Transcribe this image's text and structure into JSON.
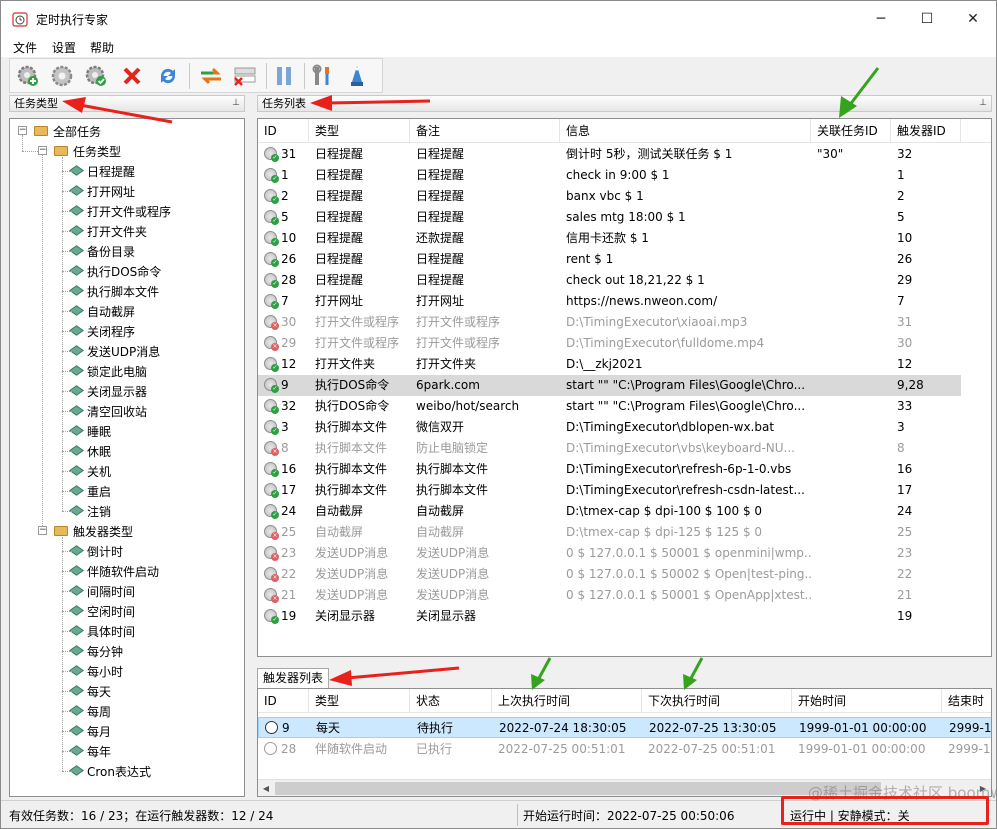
{
  "window": {
    "title": "定时执行专家",
    "minimize": "─",
    "maximize": "☐",
    "close": "✕"
  },
  "menu": [
    "文件",
    "设置",
    "帮助"
  ],
  "toolbar": {
    "buttons": [
      "add-task-icon",
      "gear-icon",
      "gear-check-icon",
      "delete-icon",
      "refresh-icon",
      "swap-icon",
      "remove-trigger-icon",
      "pause-icon",
      "tools-icon",
      "wizard-icon"
    ]
  },
  "left_panel": {
    "header": "任务类型",
    "pin": "📌",
    "root": "全部任务",
    "task_type_group": "任务类型",
    "task_types": [
      "日程提醒",
      "打开网址",
      "打开文件或程序",
      "打开文件夹",
      "备份目录",
      "执行DOS命令",
      "执行脚本文件",
      "自动截屏",
      "关闭程序",
      "发送UDP消息",
      "锁定此电脑",
      "关闭显示器",
      "清空回收站",
      "睡眠",
      "休眠",
      "关机",
      "重启",
      "注销"
    ],
    "trigger_type_group": "触发器类型",
    "trigger_types": [
      "倒计时",
      "伴随软件启动",
      "间隔时间",
      "空闲时间",
      "具体时间",
      "每分钟",
      "每小时",
      "每天",
      "每周",
      "每月",
      "每年",
      "Cron表达式"
    ]
  },
  "task_panel": {
    "header": "任务列表",
    "pin": "📌",
    "columns": [
      "ID",
      "类型",
      "备注",
      "信息",
      "关联任务ID",
      "触发器ID"
    ],
    "rows": [
      {
        "id": "31",
        "type": "日程提醒",
        "note": "日程提醒",
        "info": "倒计时 5秒，测试关联任务 $ 1",
        "rel": "\"30\"",
        "trig": "32",
        "enabled": true
      },
      {
        "id": "1",
        "type": "日程提醒",
        "note": "日程提醒",
        "info": "check in 9:00 $ 1",
        "rel": "",
        "trig": "1",
        "enabled": true
      },
      {
        "id": "2",
        "type": "日程提醒",
        "note": "日程提醒",
        "info": "banx vbc $ 1",
        "rel": "",
        "trig": "2",
        "enabled": true
      },
      {
        "id": "5",
        "type": "日程提醒",
        "note": "日程提醒",
        "info": "sales mtg 18:00 $ 1",
        "rel": "",
        "trig": "5",
        "enabled": true
      },
      {
        "id": "10",
        "type": "日程提醒",
        "note": "还款提醒",
        "info": "信用卡还款 $ 1",
        "rel": "",
        "trig": "10",
        "enabled": true
      },
      {
        "id": "26",
        "type": "日程提醒",
        "note": "日程提醒",
        "info": "rent $ 1",
        "rel": "",
        "trig": "26",
        "enabled": true
      },
      {
        "id": "28",
        "type": "日程提醒",
        "note": "日程提醒",
        "info": "check out 18,21,22 $ 1",
        "rel": "",
        "trig": "29",
        "enabled": true
      },
      {
        "id": "7",
        "type": "打开网址",
        "note": "打开网址",
        "info": "https://news.nweon.com/",
        "rel": "",
        "trig": "7",
        "enabled": true
      },
      {
        "id": "30",
        "type": "打开文件或程序",
        "note": "打开文件或程序",
        "info": "D:\\TimingExecutor\\xiaoai.mp3",
        "rel": "",
        "trig": "31",
        "enabled": false
      },
      {
        "id": "29",
        "type": "打开文件或程序",
        "note": "打开文件或程序",
        "info": "D:\\TimingExecutor\\fulldome.mp4",
        "rel": "",
        "trig": "30",
        "enabled": false
      },
      {
        "id": "12",
        "type": "打开文件夹",
        "note": "打开文件夹",
        "info": "D:\\__zkj2021",
        "rel": "",
        "trig": "12",
        "enabled": true
      },
      {
        "id": "9",
        "type": "执行DOS命令",
        "note": "6park.com",
        "info": "start \"\" \"C:\\Program Files\\Google\\Chro...",
        "rel": "",
        "trig": "9,28",
        "enabled": true,
        "selected": true
      },
      {
        "id": "32",
        "type": "执行DOS命令",
        "note": "weibo/hot/search",
        "info": "start \"\" \"C:\\Program Files\\Google\\Chro...",
        "rel": "",
        "trig": "33",
        "enabled": true
      },
      {
        "id": "3",
        "type": "执行脚本文件",
        "note": "微信双开",
        "info": "D:\\TimingExecutor\\dblopen-wx.bat",
        "rel": "",
        "trig": "3",
        "enabled": true
      },
      {
        "id": "8",
        "type": "执行脚本文件",
        "note": "防止电脑锁定",
        "info": "D:\\TimingExecutor\\vbs\\keyboard-NU...",
        "rel": "",
        "trig": "8",
        "enabled": false
      },
      {
        "id": "16",
        "type": "执行脚本文件",
        "note": "执行脚本文件",
        "info": "D:\\TimingExecutor\\refresh-6p-1-0.vbs",
        "rel": "",
        "trig": "16",
        "enabled": true
      },
      {
        "id": "17",
        "type": "执行脚本文件",
        "note": "执行脚本文件",
        "info": "D:\\TimingExecutor\\refresh-csdn-latest...",
        "rel": "",
        "trig": "17",
        "enabled": true
      },
      {
        "id": "24",
        "type": "自动截屏",
        "note": "自动截屏",
        "info": "D:\\tmex-cap $ dpi-100 $ 100 $ 0",
        "rel": "",
        "trig": "24",
        "enabled": true
      },
      {
        "id": "25",
        "type": "自动截屏",
        "note": "自动截屏",
        "info": "D:\\tmex-cap $ dpi-125 $ 125 $ 0",
        "rel": "",
        "trig": "25",
        "enabled": false
      },
      {
        "id": "23",
        "type": "发送UDP消息",
        "note": "发送UDP消息",
        "info": "0 $ 127.0.0.1 $ 50001 $ openmini|wmp...",
        "rel": "",
        "trig": "23",
        "enabled": false
      },
      {
        "id": "22",
        "type": "发送UDP消息",
        "note": "发送UDP消息",
        "info": "0 $ 127.0.0.1 $ 50002 $ Open|test-ping...",
        "rel": "",
        "trig": "22",
        "enabled": false
      },
      {
        "id": "21",
        "type": "发送UDP消息",
        "note": "发送UDP消息",
        "info": "0 $ 127.0.0.1 $ 50001 $ OpenApp|xtest...",
        "rel": "",
        "trig": "21",
        "enabled": false
      },
      {
        "id": "19",
        "type": "关闭显示器",
        "note": "关闭显示器",
        "info": "",
        "rel": "",
        "trig": "19",
        "enabled": true
      }
    ]
  },
  "trigger_panel": {
    "tab": "触发器列表",
    "columns": [
      "ID",
      "类型",
      "状态",
      "上次执行时间",
      "下次执行时间",
      "开始时间",
      "结束时"
    ],
    "rows": [
      {
        "id": "9",
        "type": "每天",
        "state": "待执行",
        "last": "2022-07-24 18:30:05",
        "next": "2022-07-25 13:30:05",
        "start": "1999-01-01 00:00:00",
        "end": "2999-1",
        "active": true
      },
      {
        "id": "28",
        "type": "伴随软件启动",
        "state": "已执行",
        "last": "2022-07-25 00:51:01",
        "next": "2022-07-25 00:51:01",
        "start": "1999-01-01 00:00:00",
        "end": "2999-1",
        "active": false
      }
    ]
  },
  "status": {
    "tasks": "有效任务数：16 / 23；在运行触发器数：12 / 24",
    "start_time": "开始运行时间：2022-07-25 00:50:06",
    "mode": "运行中 | 安静模式：关"
  },
  "watermark": "@稀土掘金技术社区 boomworks",
  "colors": {
    "arrow_red": "#e8211b",
    "arrow_green": "#35a31d",
    "selected_row": "#d9d9d9",
    "trigger_selected": "#cce8ff"
  }
}
